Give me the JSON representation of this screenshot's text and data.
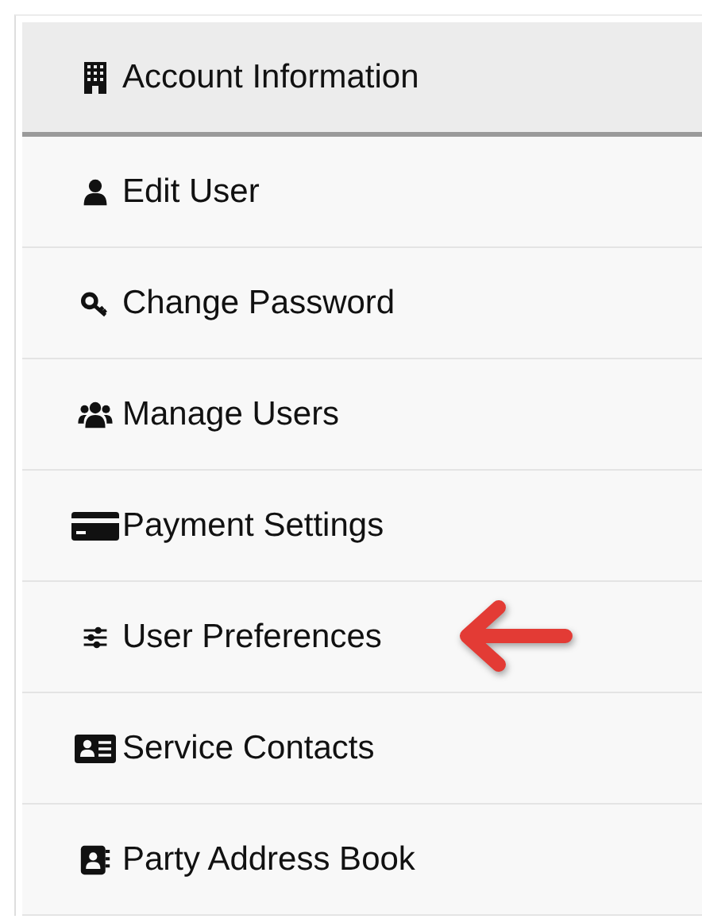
{
  "header": {
    "label": "Account Information"
  },
  "items": [
    {
      "label": "Edit User",
      "marked": false
    },
    {
      "label": "Change Password",
      "marked": false
    },
    {
      "label": "Manage Users",
      "marked": false
    },
    {
      "label": "Payment Settings",
      "marked": false
    },
    {
      "label": "User Preferences",
      "marked": true
    },
    {
      "label": "Service Contacts",
      "marked": false
    },
    {
      "label": "Party Address Book",
      "marked": false
    }
  ]
}
